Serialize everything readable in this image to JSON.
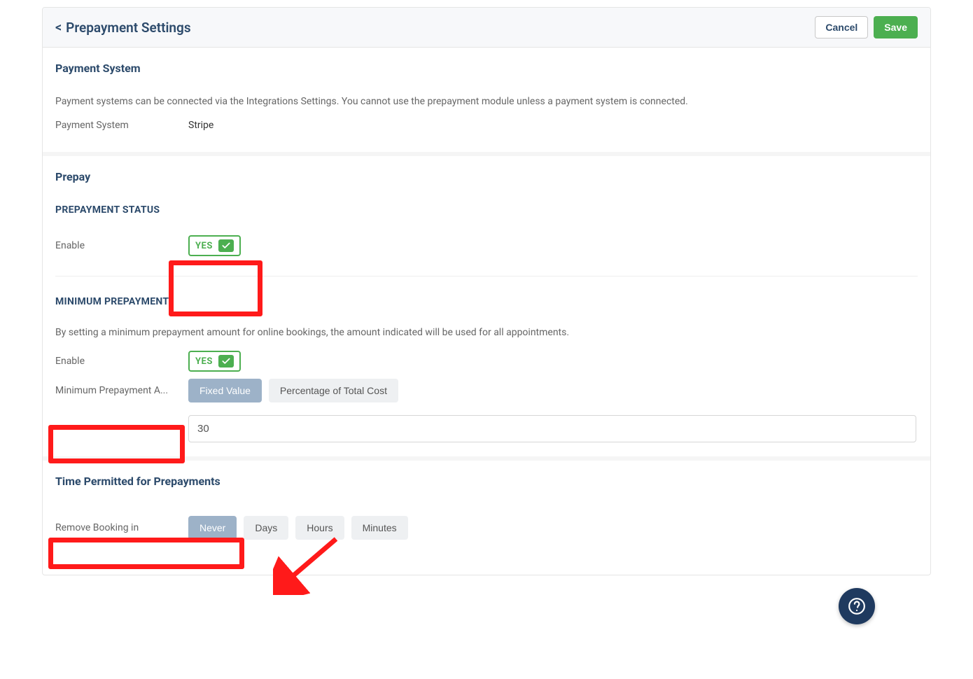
{
  "header": {
    "back_chevron": "<",
    "title": "Prepayment Settings",
    "cancel_label": "Cancel",
    "save_label": "Save"
  },
  "payment_system": {
    "title": "Payment System",
    "description": "Payment systems can be connected via the Integrations Settings. You cannot use the prepayment module unless a payment system is connected.",
    "label": "Payment System",
    "value": "Stripe"
  },
  "prepay": {
    "title": "Prepay",
    "status_heading": "PREPAYMENT STATUS",
    "status_enable_label": "Enable",
    "status_toggle_text": "YES",
    "min_heading": "MINIMUM PREPAYMENT",
    "min_description": "By setting a minimum prepayment amount for online bookings, the amount indicated will be used for all appointments.",
    "min_enable_label": "Enable",
    "min_toggle_text": "YES",
    "min_amount_label": "Minimum Prepayment A...",
    "min_type_options": [
      "Fixed Value",
      "Percentage of Total Cost"
    ],
    "min_type_selected": "Fixed Value",
    "min_amount_value": "30"
  },
  "time_permitted": {
    "title": "Time Permitted for Prepayments",
    "remove_label": "Remove Booking in",
    "options": [
      "Never",
      "Days",
      "Hours",
      "Minutes"
    ],
    "selected": "Never"
  },
  "colors": {
    "accent_blue": "#2c4a6b",
    "green": "#4caf50",
    "highlight_red": "#ff1a1a",
    "segment_active": "#9db2c8"
  }
}
